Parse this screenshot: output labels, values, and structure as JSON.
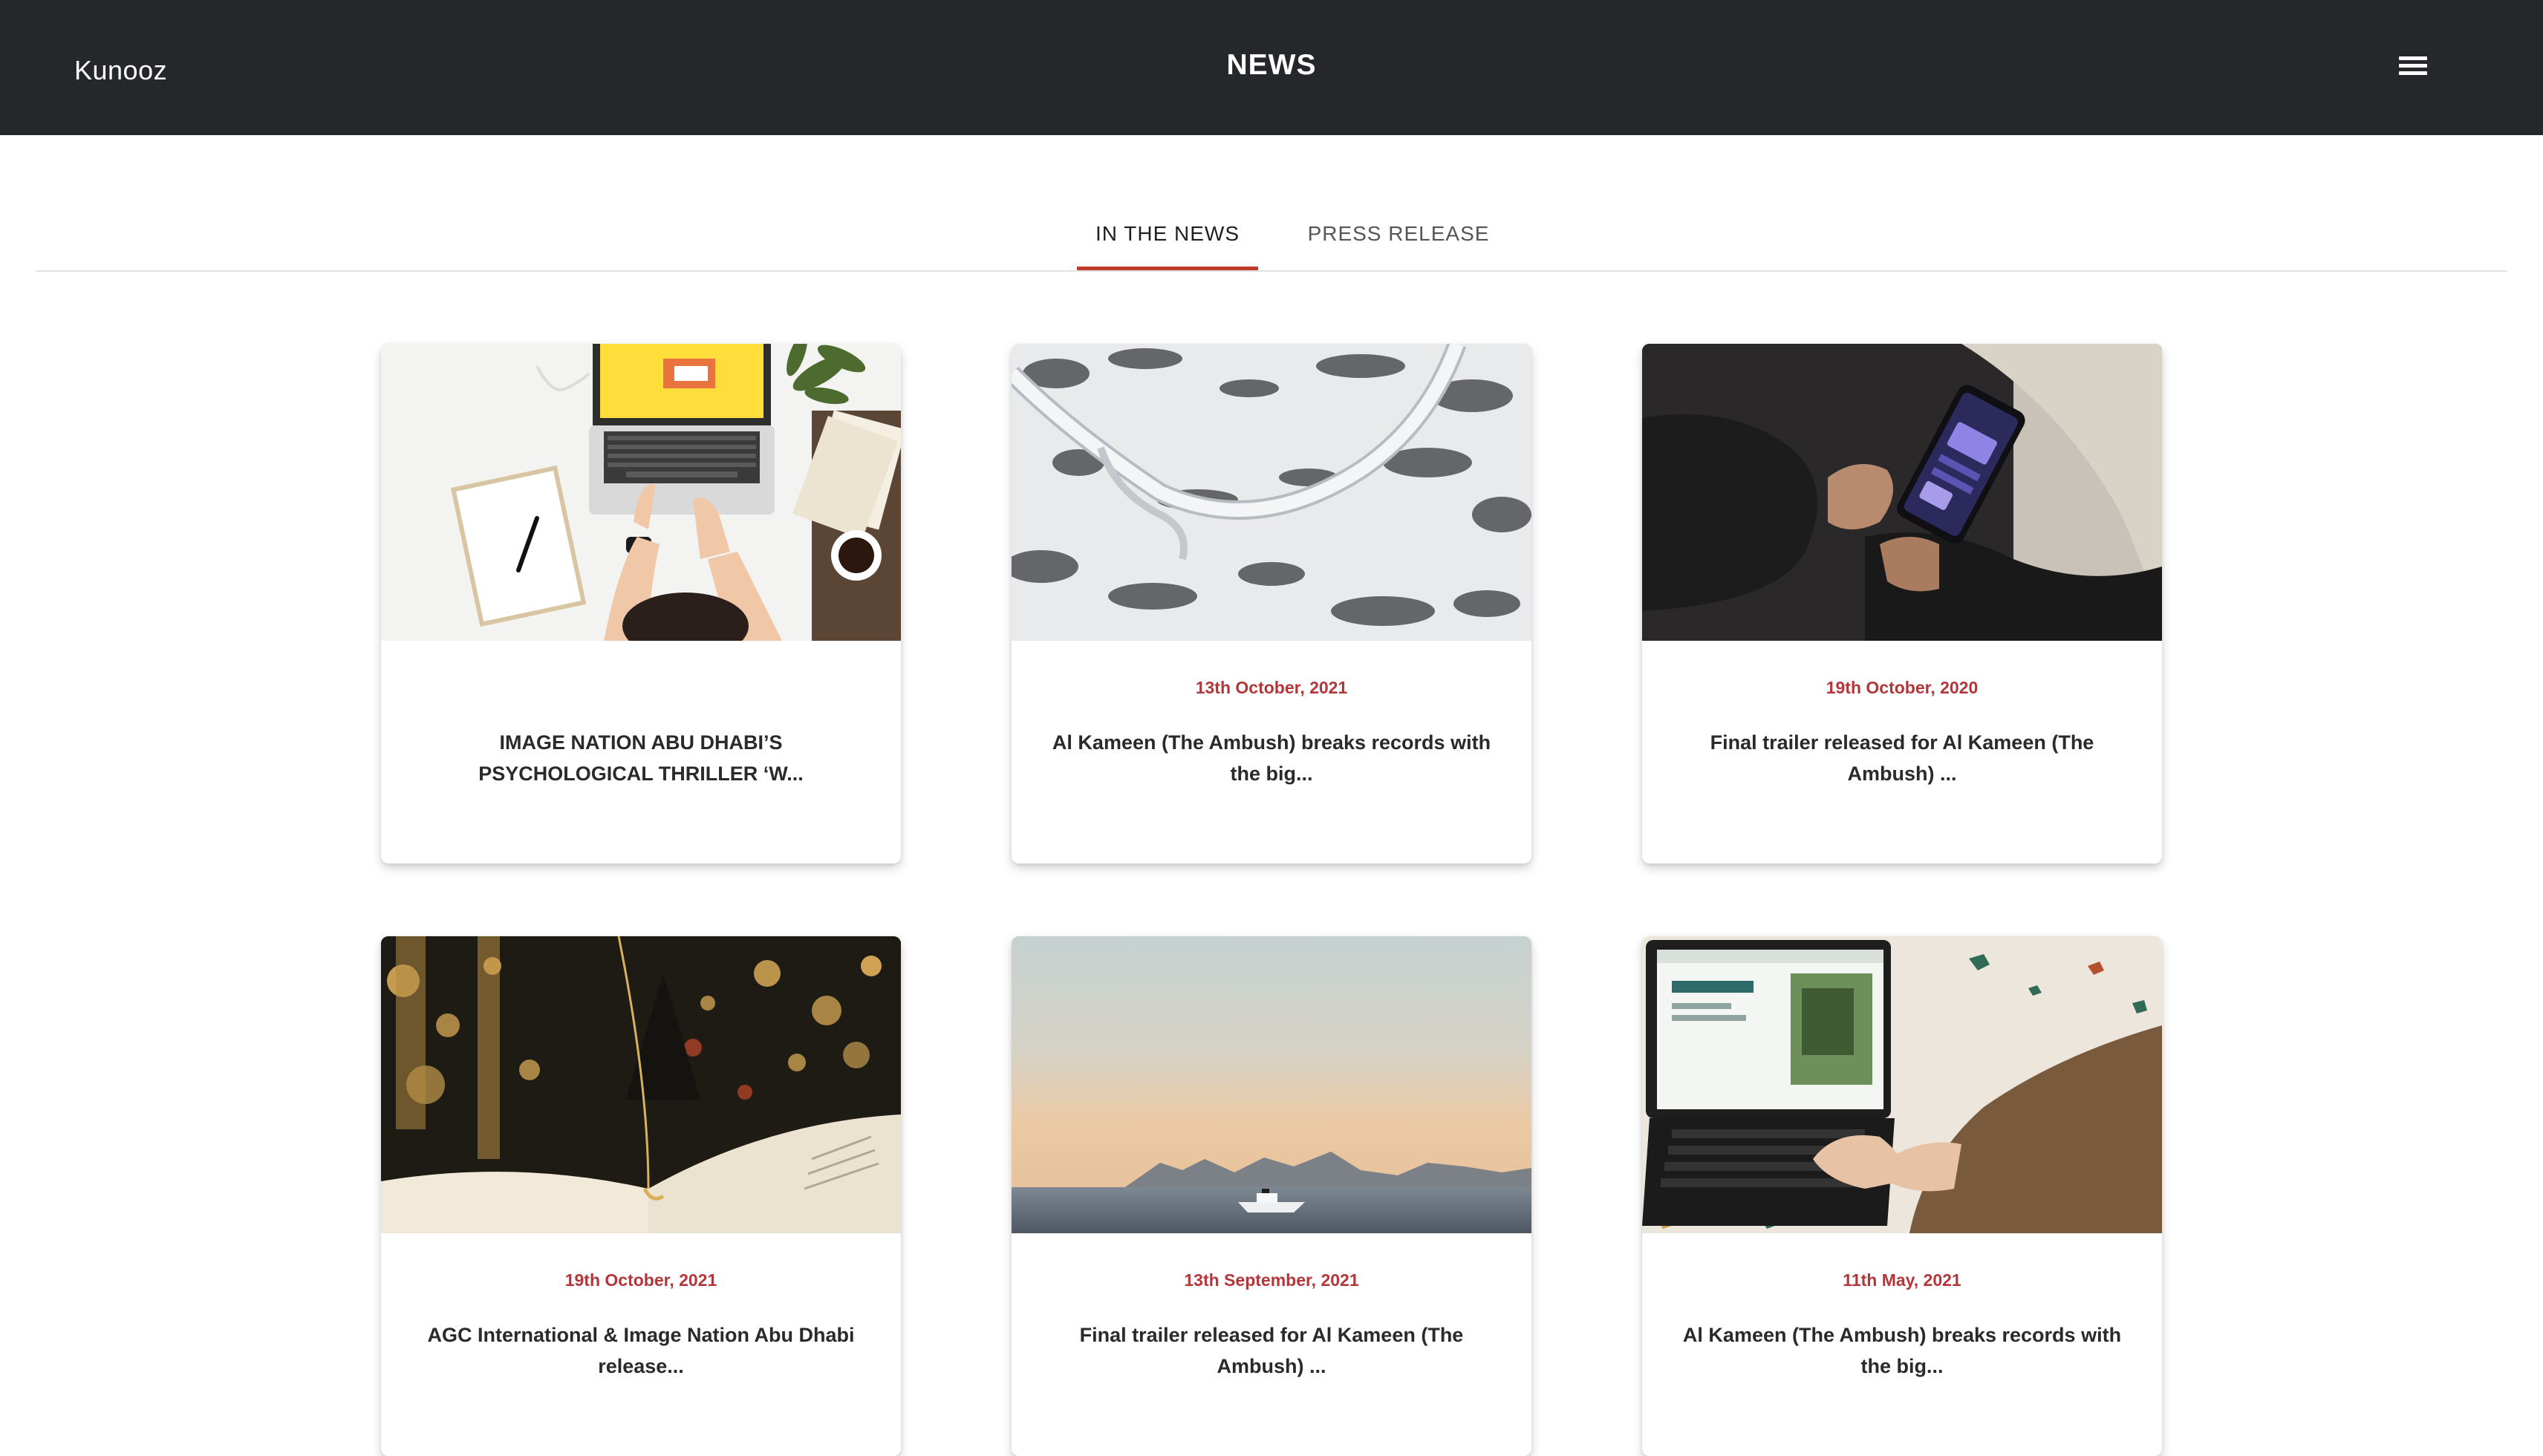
{
  "header": {
    "brand": "Kunooz",
    "title": "NEWS",
    "menu_icon": "hamburger-menu-icon"
  },
  "tabs": [
    {
      "label": "IN THE NEWS",
      "active": true
    },
    {
      "label": "PRESS RELEASE",
      "active": false
    }
  ],
  "colors": {
    "header_bg": "#25272b",
    "accent": "#c0392b",
    "date_text": "#b3363a"
  },
  "cards": [
    {
      "image": "laptop-desk-photo",
      "date": "",
      "headline": "IMAGE NATION ABU DHABI’S PSYCHOLOGICAL THRILLER ‘W..."
    },
    {
      "image": "snowy-road-aerial-photo",
      "date": "13th October, 2021",
      "headline": "Al Kameen (The Ambush) breaks records with the big..."
    },
    {
      "image": "phone-in-hands-photo",
      "date": "19th October, 2020",
      "headline": "Final trailer released for Al Kameen (The Ambush) ..."
    },
    {
      "image": "necklace-book-bokeh-photo",
      "date": "19th October, 2021",
      "headline": "AGC International & Image Nation Abu Dhabi release..."
    },
    {
      "image": "boat-sea-sunset-photo",
      "date": "13th September, 2021",
      "headline": "Final trailer released for Al Kameen (The Ambush) ..."
    },
    {
      "image": "tablet-keyboard-photo",
      "date": "11th May, 2021",
      "headline": "Al Kameen (The Ambush) breaks records with the big..."
    }
  ]
}
